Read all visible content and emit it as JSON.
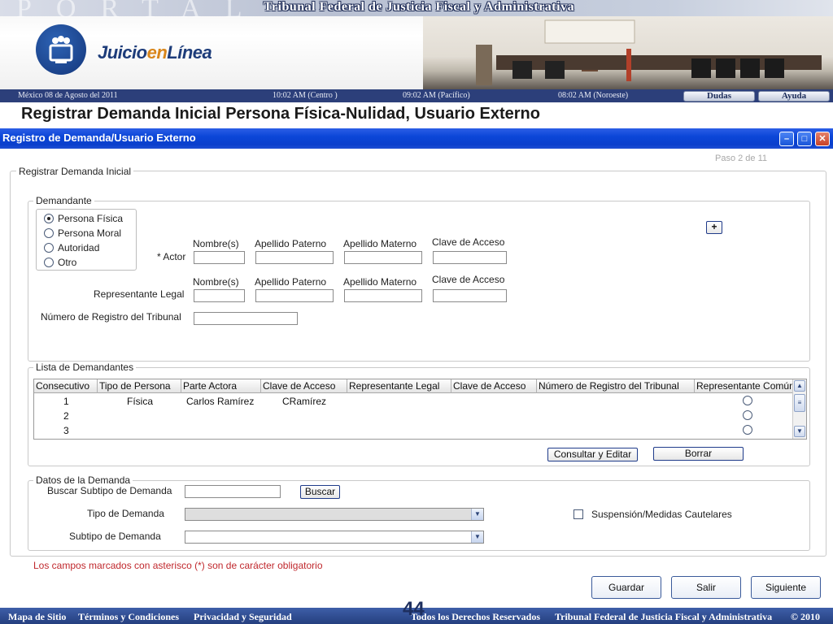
{
  "banner": {
    "bg_text": "PORTAL",
    "title": "Tribunal Federal de Justicia Fiscal y Administrativa",
    "logo_text_a": "Juicio",
    "logo_text_b": "en",
    "logo_text_c": "Línea"
  },
  "infobar": {
    "date": "México 08 de Agosto del 2011",
    "time_centro": "10:02  AM (Centro )",
    "time_pacifico": "09:02 AM  (Pacífico)",
    "time_noroeste": "08:02 AM (Noroeste)",
    "dudas": "Dudas",
    "ayuda": "Ayuda"
  },
  "heading": "Registrar Demanda Inicial Persona Física-Nulidad, Usuario Externo",
  "window": {
    "title": "Registro de Demanda/Usuario Externo",
    "step": "Paso 2 de 11"
  },
  "registro": {
    "legend": "Registrar Demanda Inicial"
  },
  "demandante": {
    "legend": "Demandante",
    "options": [
      "Persona Física",
      "Persona Moral",
      "Autoridad",
      "Otro"
    ],
    "selected": "Persona Física",
    "add_label": "+",
    "col_nombre": "Nombre(s)",
    "col_paterno": "Apellido Paterno",
    "col_materno": "Apellido Materno",
    "col_clave": "Clave de Acceso",
    "actor_label": "* Actor",
    "rep_label": "Representante Legal",
    "registro_label": "Número de Registro del Tribunal"
  },
  "lista": {
    "legend": "Lista de Demandantes",
    "columns": [
      "Consecutivo",
      "Tipo de Persona",
      "Parte Actora",
      "Clave de Acceso",
      "Representante Legal",
      "Clave de Acceso",
      "Número de Registro del Tribunal",
      "Representante Común"
    ],
    "rows": [
      {
        "consecutivo": "1",
        "tipo": "Física",
        "parte": "Carlos Ramírez",
        "clave": "CRamírez"
      },
      {
        "consecutivo": "2",
        "tipo": "",
        "parte": "",
        "clave": ""
      },
      {
        "consecutivo": "3",
        "tipo": "",
        "parte": "",
        "clave": ""
      }
    ],
    "consultar": "Consultar y Editar",
    "borrar": "Borrar"
  },
  "datos": {
    "legend": "Datos de la Demanda",
    "buscar_label": "Buscar Subtipo de Demanda",
    "buscar_btn": "Buscar",
    "tipo_label": "Tipo de Demanda",
    "subtipo_label": "Subtipo de Demanda",
    "suspension_label": "Suspensión/Medidas Cautelares"
  },
  "note": "Los campos marcados con asterisco (*) son de carácter obligatorio",
  "actions": {
    "guardar": "Guardar",
    "salir": "Salir",
    "siguiente": "Siguiente"
  },
  "footer": {
    "mapa": "Mapa de Sitio",
    "terminos": "Términos y Condiciones",
    "privacidad": "Privacidad y Seguridad",
    "derechos": "Todos los Derechos Reservados",
    "tribunal": "Tribunal Federal de Justicia Fiscal y Administrativa",
    "copyright": "© 2010",
    "page": "44"
  },
  "colors": {
    "titlebar": "#0b46d8",
    "infobar": "#2c3f7a",
    "note": "#c0282d"
  }
}
